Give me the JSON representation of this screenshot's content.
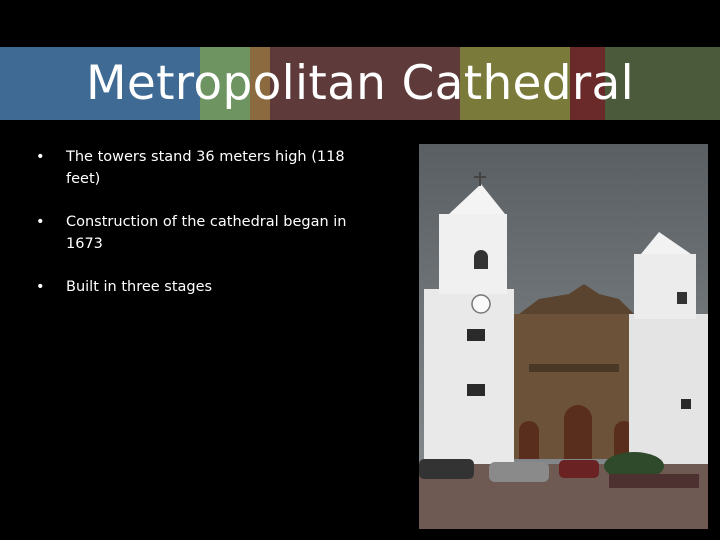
{
  "slide": {
    "title": "Metropolitan Cathedral",
    "bullet_symbol": "•",
    "bullets": [
      "The towers stand 36 meters high (118 feet)",
      "Construction of the cathedral began in 1673",
      "Built in three stages"
    ],
    "band_colors": [
      "#3e6a94",
      "#6e9461",
      "#8a6a3e",
      "#5e3a3a",
      "#7a7a3a",
      "#6a2a2a",
      "#4a5a3a"
    ]
  }
}
